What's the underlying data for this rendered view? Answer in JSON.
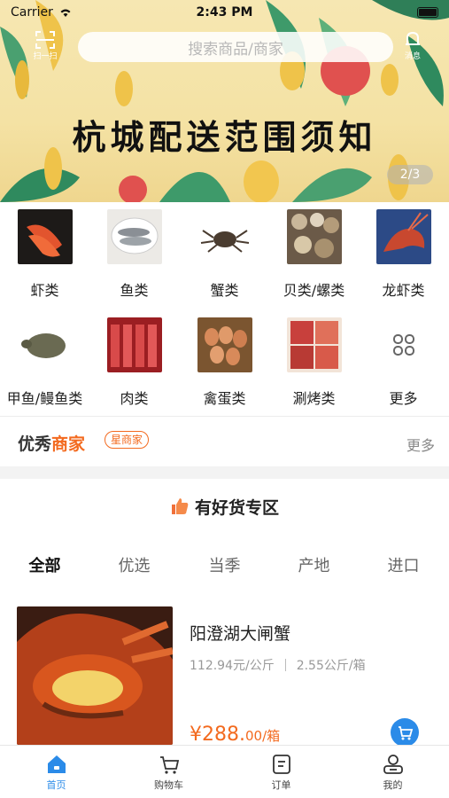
{
  "status_bar": {
    "carrier": "Carrier",
    "time": "2:43 PM"
  },
  "header": {
    "scan_label": "扫一扫",
    "search_placeholder": "搜索商品/商家",
    "message_label": "消息"
  },
  "banner": {
    "title": "杭城配送范围须知",
    "page_indicator": "2/3"
  },
  "categories": [
    {
      "label": "虾类",
      "icon": "shrimp-image"
    },
    {
      "label": "鱼类",
      "icon": "fish-image"
    },
    {
      "label": "蟹类",
      "icon": "crab-image"
    },
    {
      "label": "贝类/螺类",
      "icon": "shellfish-image"
    },
    {
      "label": "龙虾类",
      "icon": "lobster-image"
    },
    {
      "label": "甲鱼/鳗鱼类",
      "icon": "turtle-image"
    },
    {
      "label": "肉类",
      "icon": "meat-image"
    },
    {
      "label": "禽蛋类",
      "icon": "eggs-image"
    },
    {
      "label": "涮烤类",
      "icon": "bbq-image"
    },
    {
      "label": "更多",
      "icon": "more-grid-icon"
    }
  ],
  "merchant": {
    "title_part1": "优秀",
    "title_part2": "商家",
    "badge": "星商家",
    "more": "更多"
  },
  "zone": {
    "title": "有好货专区"
  },
  "filter_tabs": [
    "全部",
    "优选",
    "当季",
    "产地",
    "进口"
  ],
  "active_tab": "全部",
  "product": {
    "name": "阳澄湖大闸蟹",
    "unit_price": "112.94元/公斤",
    "weight": "2.55公斤/箱",
    "price_main": "¥288.",
    "price_decimal": "00/箱"
  },
  "tabbar": [
    {
      "label": "首页",
      "icon": "home-icon"
    },
    {
      "label": "购物车",
      "icon": "cart-icon"
    },
    {
      "label": "订单",
      "icon": "order-icon"
    },
    {
      "label": "我的",
      "icon": "profile-icon"
    }
  ],
  "colors": {
    "accent": "#2b8be8",
    "orange": "#f36a1f",
    "banner_bg": "#f4e2a4"
  }
}
